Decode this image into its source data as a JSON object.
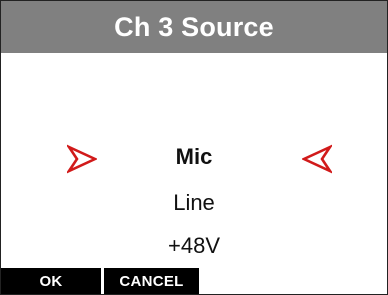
{
  "header": {
    "title": "Ch 3 Source"
  },
  "options": [
    {
      "label": "Mic",
      "selected": true
    },
    {
      "label": "Line",
      "selected": false
    },
    {
      "label": "+48V",
      "selected": false
    }
  ],
  "selection_arrows": {
    "left_icon": "arrow-right-icon",
    "right_icon": "arrow-left-icon",
    "color": "#d11a1a"
  },
  "softkeys": {
    "ok_label": "OK",
    "cancel_label": "CANCEL"
  },
  "colors": {
    "header_bg": "#808080",
    "softkey_bg": "#000000",
    "accent": "#d11a1a"
  }
}
